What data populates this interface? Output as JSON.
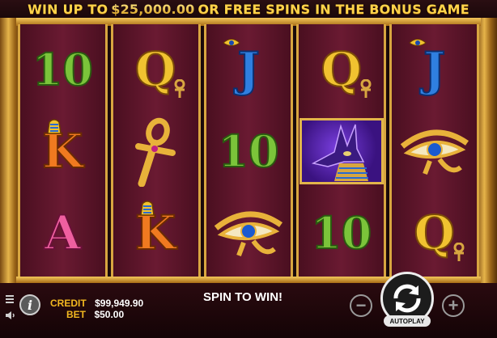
{
  "banner": {
    "prefix": "WIN UP TO",
    "amount": "$25,000.00",
    "suffix": "OR FREE SPINS IN THE BONUS GAME"
  },
  "reels": [
    [
      "10",
      "K",
      "A"
    ],
    [
      "Q",
      "ankh",
      "K"
    ],
    [
      "J",
      "10",
      "eye"
    ],
    [
      "Q",
      "anubis",
      "10"
    ],
    [
      "J",
      "eye",
      "Q"
    ]
  ],
  "symbols": {
    "10": "10",
    "Q": "Q",
    "J": "J",
    "K": "K",
    "A": "A"
  },
  "status": {
    "credit_label": "CREDIT",
    "credit_value": "$99,949.90",
    "bet_label": "BET",
    "bet_value": "$50.00",
    "message": "SPIN TO WIN!"
  },
  "controls": {
    "info_label": "i",
    "minus_label": "−",
    "plus_label": "+",
    "autoplay_label": "AUTOPLAY",
    "minus_icon": "minus-icon",
    "plus_icon": "plus-icon",
    "spin_icon": "spin-arrows-icon",
    "menu_icon": "menu-icon",
    "sound_icon": "sound-icon"
  },
  "colors": {
    "gold": "#e2b54a",
    "reel_bg": "#6a1a32",
    "label_gold": "#f2b820"
  }
}
